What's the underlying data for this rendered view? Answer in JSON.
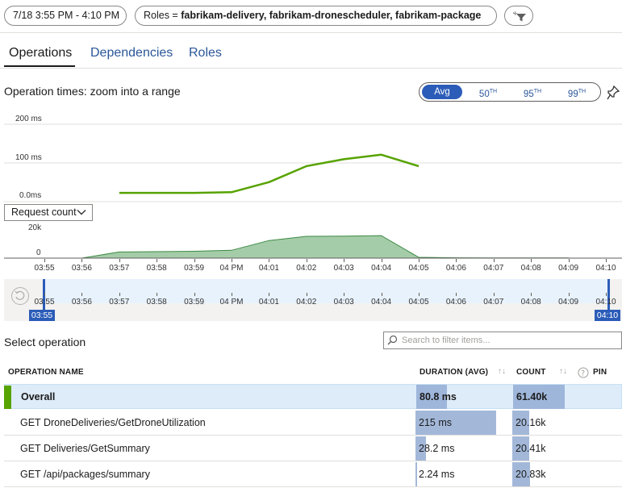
{
  "filters": {
    "time_range": "7/18 3:55 PM - 4:10 PM",
    "roles_prefix": "Roles = ",
    "roles_value": "fabrikam-delivery, fabrikam-dronescheduler, fabrikam-package",
    "add_filter_icon": "filter-add-icon"
  },
  "tabs": [
    {
      "label": "Operations",
      "active": true
    },
    {
      "label": "Dependencies",
      "active": false
    },
    {
      "label": "Roles",
      "active": false
    }
  ],
  "chart_section": {
    "title": "Operation times: zoom into a range",
    "percentiles": [
      {
        "label": "Avg",
        "sup": "",
        "selected": true
      },
      {
        "label": "50",
        "sup": "TH",
        "selected": false
      },
      {
        "label": "95",
        "sup": "TH",
        "selected": false
      },
      {
        "label": "99",
        "sup": "TH",
        "selected": false
      }
    ],
    "pin_icon": "pin-icon"
  },
  "chart_data": [
    {
      "type": "line",
      "y_ticks": [
        "200 ms",
        "100 ms",
        "0.0ms"
      ],
      "ylim": [
        0,
        200
      ],
      "x": [
        "03:57",
        "03:58",
        "03:59",
        "04 PM",
        "04:01",
        "04:02",
        "04:03",
        "04:04",
        "04:05"
      ],
      "series": [
        {
          "values": [
            2,
            2,
            2,
            4,
            33,
            79,
            99,
            112,
            79
          ]
        }
      ],
      "color": "#57a300"
    },
    {
      "type": "area",
      "y_ticks": [
        "20k",
        "0"
      ],
      "ylim": [
        0,
        20000
      ],
      "x": [
        "03:55",
        "03:56",
        "03:57",
        "03:58",
        "03:59",
        "04 PM",
        "04:01",
        "04:02",
        "04:03",
        "04:04",
        "04:05",
        "04:06",
        "04:07",
        "04:08",
        "04:09"
      ],
      "series": [
        {
          "values": [
            0,
            0,
            4000,
            4200,
            4500,
            5100,
            11500,
            14200,
            14300,
            14700,
            500,
            200,
            100,
            100,
            100
          ]
        }
      ],
      "color": "#a4cca8"
    }
  ],
  "metric_select": {
    "value": "Request count"
  },
  "time_ticks": [
    "03:55",
    "03:56",
    "03:57",
    "03:58",
    "03:59",
    "04 PM",
    "04:01",
    "04:02",
    "04:03",
    "04:04",
    "04:05",
    "04:06",
    "04:07",
    "04:08",
    "04:09",
    "04:10"
  ],
  "brush": {
    "start_label": "03:55",
    "end_label": "04:10",
    "reset_icon": "reset-zoom-icon"
  },
  "operations": {
    "title": "Select operation",
    "search_placeholder": "Search to filter items...",
    "columns": {
      "name": "OPERATION NAME",
      "duration": "DURATION (AVG)",
      "count": "COUNT",
      "pin": "PIN"
    },
    "sort_icon": "↑↓",
    "rows": [
      {
        "name": "Overall",
        "duration": "80.8 ms",
        "count": "61.40k",
        "duration_value": 80.8,
        "count_value": 61400
      },
      {
        "name": "GET DroneDeliveries/GetDroneUtilization",
        "duration": "215 ms",
        "count": "20.16k",
        "duration_value": 215,
        "count_value": 20160
      },
      {
        "name": "GET Deliveries/GetSummary",
        "duration": "28.2 ms",
        "count": "20.41k",
        "duration_value": 28.2,
        "count_value": 20410
      },
      {
        "name": "GET /api/packages/summary",
        "duration": "2.24 ms",
        "count": "20.83k",
        "duration_value": 2.24,
        "count_value": 20830
      }
    ]
  }
}
